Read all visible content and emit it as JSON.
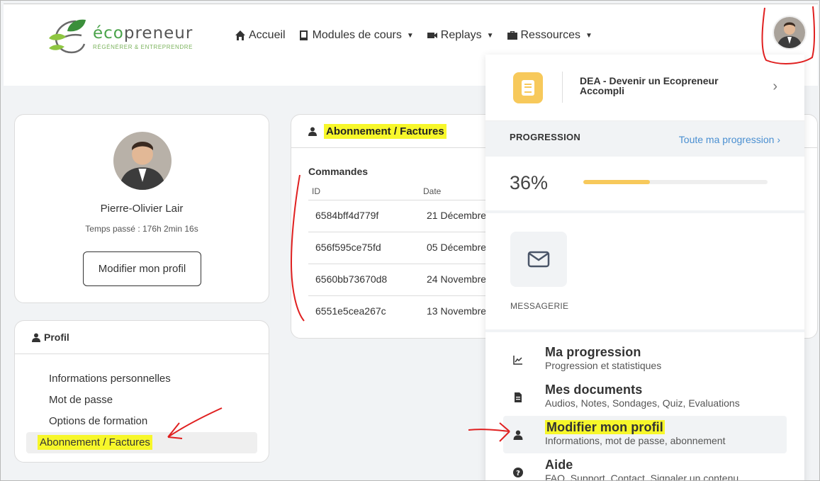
{
  "brand": {
    "word_prefix": "éco",
    "word_suffix": "preneur",
    "tagline": "RÉGÉNÉRER & ENTREPRENDRE",
    "green": "#4aa34a"
  },
  "nav": [
    {
      "label": "Accueil",
      "icon": "home-icon",
      "caret": false
    },
    {
      "label": "Modules de cours",
      "icon": "book-icon",
      "caret": true
    },
    {
      "label": "Replays",
      "icon": "video-icon",
      "caret": true
    },
    {
      "label": "Ressources",
      "icon": "briefcase-icon",
      "caret": true
    }
  ],
  "profile": {
    "name": "Pierre-Olivier Lair",
    "time_spent": "Temps passé : 176h 2min 16s",
    "edit_button": "Modifier mon profil"
  },
  "profil_menu": {
    "title": "Profil",
    "items": [
      {
        "label": "Informations personnelles",
        "active": false
      },
      {
        "label": "Mot de passe",
        "active": false
      },
      {
        "label": "Options de formation",
        "active": false
      },
      {
        "label": "Abonnement / Factures",
        "active": true
      }
    ]
  },
  "orders": {
    "title": "Abonnement / Factures",
    "section": "Commandes",
    "headers": [
      "ID",
      "Date"
    ],
    "rows": [
      {
        "id": "6584bff4d779f",
        "date": "21 Décembre"
      },
      {
        "id": "656f595ce75fd",
        "date": "05 Décembre"
      },
      {
        "id": "6560bb73670d8",
        "date": "24 Novembre"
      },
      {
        "id": "6551e5cea267c",
        "date": "13 Novembre"
      }
    ]
  },
  "dropdown": {
    "course_title": "DEA - Devenir un Ecopreneur Accompli",
    "progress_label": "PROGRESSION",
    "progress_link": "Toute ma progression",
    "progress_value": "36%",
    "progress_fraction": 0.36,
    "messaging_label": "MESSAGERIE",
    "links": [
      {
        "title": "Ma progression",
        "subtitle": "Progression et statistiques",
        "icon": "chart-icon",
        "active": false
      },
      {
        "title": "Mes documents",
        "subtitle": "Audios, Notes, Sondages, Quiz, Evaluations",
        "icon": "document-icon",
        "active": false
      },
      {
        "title": "Modifier mon profil",
        "subtitle": "Informations, mot de passe, abonnement",
        "icon": "user-icon",
        "active": true
      },
      {
        "title": "Aide",
        "subtitle": "FAQ, Support, Contact, Signaler un contenu",
        "icon": "help-icon",
        "active": false
      }
    ]
  },
  "colors": {
    "highlight": "#f7f72a",
    "accent_yellow": "#f7c95b",
    "link_blue": "#4a8fd1",
    "annotation_red": "#e02020"
  }
}
